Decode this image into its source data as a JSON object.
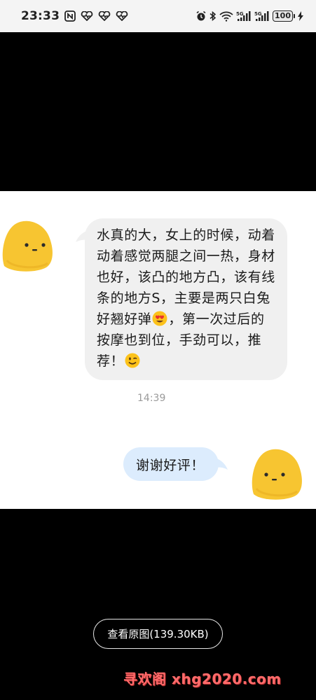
{
  "status_bar": {
    "time": "23:33",
    "battery": "100",
    "signal_label_1": "5G",
    "signal_label_2": "5G"
  },
  "chat": {
    "received": {
      "text_part1": "水真的大，女上的时候，动着动着感觉两腿之间一热，身材也好，该凸的地方凸，该有线条的地方S，主要是两只白兔好翘好弹",
      "emoji1": "heart-eyes-emoji",
      "text_part2": "，第一次过后的按摩也到位，手劲可以，推荐！",
      "emoji2": "wink-emoji"
    },
    "timestamp": "14:39",
    "sent": {
      "text": "谢谢好评！"
    }
  },
  "view_original_button": "查看原图(139.30KB)",
  "watermark": "寻欢阁 xhg2020.com",
  "colors": {
    "received_bubble": "#f0f0f0",
    "sent_bubble": "#dcecfd",
    "avatar": "#f7c531",
    "watermark": "#ff6b6b"
  }
}
